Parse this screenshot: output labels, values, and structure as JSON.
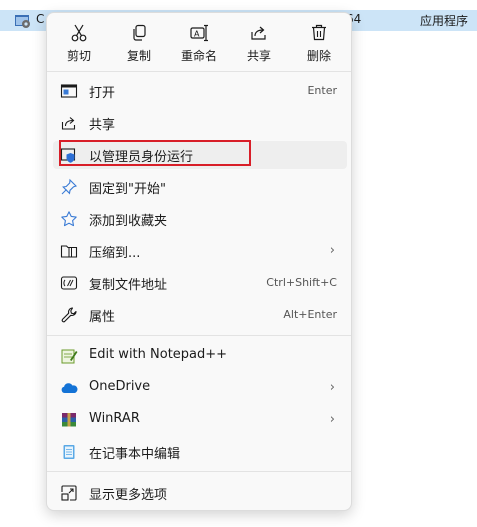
{
  "file_row": {
    "name": "C",
    "suffix": "64",
    "type": "应用程序"
  },
  "quick_actions": [
    {
      "label": "剪切",
      "icon": "scissors-icon"
    },
    {
      "label": "复制",
      "icon": "copy-icon"
    },
    {
      "label": "重命名",
      "icon": "rename-icon"
    },
    {
      "label": "共享",
      "icon": "share-icon"
    },
    {
      "label": "删除",
      "icon": "trash-icon"
    }
  ],
  "menu_items": [
    {
      "label": "打开",
      "shortcut": "Enter",
      "icon": "open-window-icon"
    },
    {
      "label": "共享",
      "shortcut": "",
      "icon": "share-icon"
    },
    {
      "label": "以管理员身份运行",
      "shortcut": "",
      "icon": "admin-shield-icon",
      "highlighted": true
    },
    {
      "label": "固定到\"开始\"",
      "shortcut": "",
      "icon": "pin-icon"
    },
    {
      "label": "添加到收藏夹",
      "shortcut": "",
      "icon": "star-icon"
    },
    {
      "label": "压缩到...",
      "submenu": true,
      "icon": "zip-folder-icon"
    },
    {
      "label": "复制文件地址",
      "shortcut": "Ctrl+Shift+C",
      "icon": "copy-path-icon"
    },
    {
      "label": "属性",
      "shortcut": "Alt+Enter",
      "icon": "wrench-icon"
    },
    {
      "label": "Edit with Notepad++",
      "shortcut": "",
      "icon": "notepadpp-icon"
    },
    {
      "label": "OneDrive",
      "submenu": true,
      "icon": "cloud-icon"
    },
    {
      "label": "WinRAR",
      "submenu": true,
      "icon": "winrar-icon"
    },
    {
      "label": "在记事本中编辑",
      "shortcut": "",
      "icon": "notepad-icon"
    },
    {
      "label": "显示更多选项",
      "shortcut": "",
      "icon": "more-options-icon"
    }
  ],
  "submenu_arrow": "›",
  "colors": {
    "accent": "#0067c0",
    "highlight_border": "#d81e28",
    "selection": "#cce4f7"
  }
}
